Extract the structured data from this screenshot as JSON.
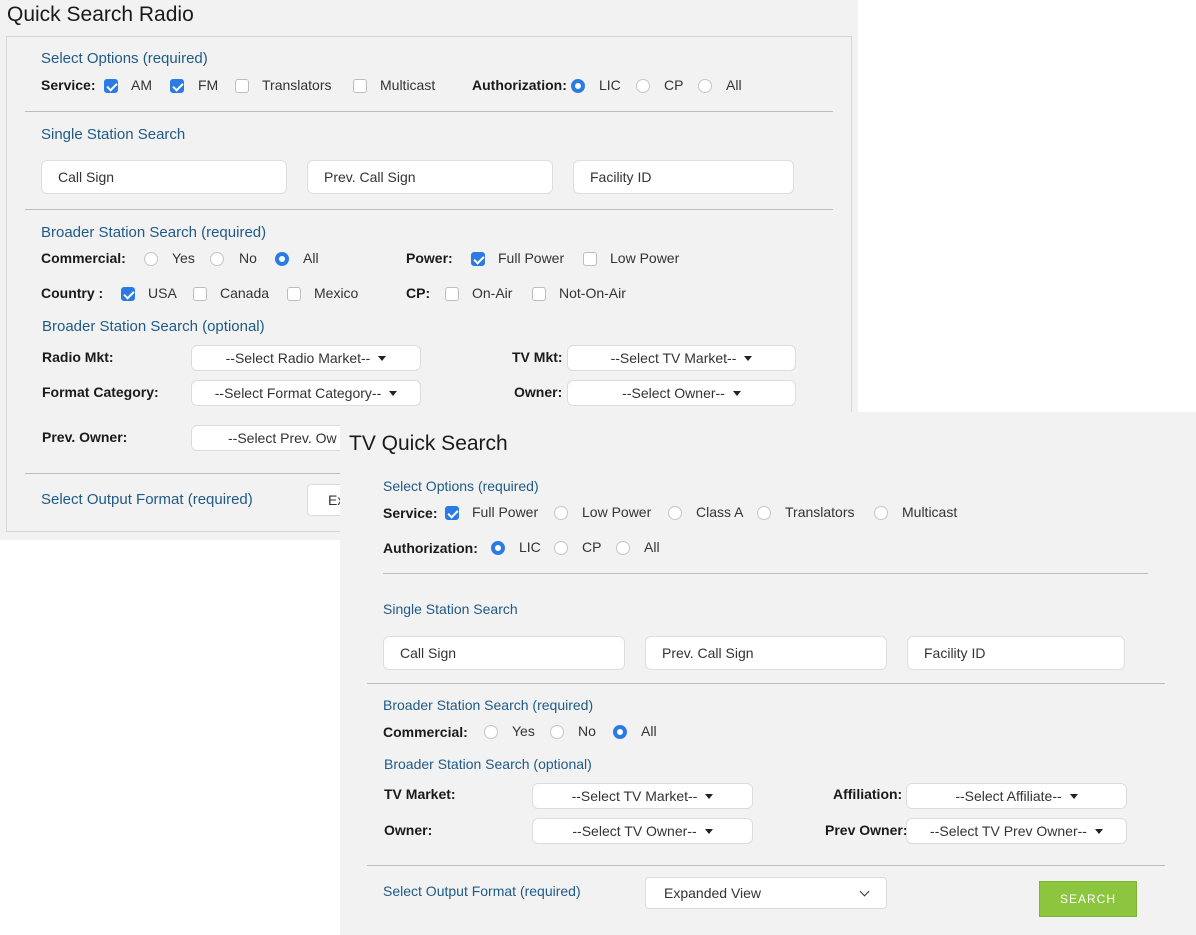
{
  "radio": {
    "title": "Quick Search Radio",
    "select_options": {
      "heading": "Select Options (required)",
      "service_label": "Service:",
      "service": [
        {
          "label": "AM",
          "checked": true
        },
        {
          "label": "FM",
          "checked": true
        },
        {
          "label": "Translators",
          "checked": false
        },
        {
          "label": "Multicast",
          "checked": false
        }
      ],
      "authorization_label": "Authorization:",
      "authorization": [
        {
          "label": "LIC",
          "checked": true
        },
        {
          "label": "CP",
          "checked": false
        },
        {
          "label": "All",
          "checked": false
        }
      ]
    },
    "single": {
      "heading": "Single Station Search",
      "call_sign": "Call Sign",
      "prev_call_sign": "Prev. Call Sign",
      "facility_id": "Facility ID"
    },
    "broader_required": {
      "heading": "Broader Station Search (required)",
      "commercial_label": "Commercial:",
      "commercial": [
        {
          "label": "Yes",
          "checked": false
        },
        {
          "label": "No",
          "checked": false
        },
        {
          "label": "All",
          "checked": true
        }
      ],
      "power_label": "Power:",
      "power": [
        {
          "label": "Full Power",
          "checked": true
        },
        {
          "label": "Low Power",
          "checked": false
        }
      ],
      "country_label": "Country :",
      "country": [
        {
          "label": "USA",
          "checked": true
        },
        {
          "label": "Canada",
          "checked": false
        },
        {
          "label": "Mexico",
          "checked": false
        }
      ],
      "cp_label": "CP:",
      "cp": [
        {
          "label": "On-Air",
          "checked": false
        },
        {
          "label": "Not-On-Air",
          "checked": false
        }
      ]
    },
    "broader_optional": {
      "heading": "Broader Station Search (optional)",
      "radio_mkt_label": "Radio Mkt:",
      "radio_mkt_value": "--Select Radio Market--",
      "tv_mkt_label": "TV Mkt:",
      "tv_mkt_value": "--Select TV Market--",
      "format_label": "Format Category:",
      "format_value": "--Select Format Category--",
      "owner_label": "Owner:",
      "owner_value": "--Select Owner--",
      "prev_owner_label": "Prev. Owner:",
      "prev_owner_value": "--Select Prev. Ow"
    },
    "output": {
      "heading": "Select Output Format (required)",
      "value": "Ex"
    }
  },
  "tv": {
    "title": "TV Quick Search",
    "select_options": {
      "heading": "Select Options (required)",
      "service_label": "Service:",
      "service": [
        {
          "label": "Full Power",
          "checked": true
        },
        {
          "label": "Low Power",
          "checked": false
        },
        {
          "label": "Class A",
          "checked": false
        },
        {
          "label": "Translators",
          "checked": false
        },
        {
          "label": "Multicast",
          "checked": false
        }
      ],
      "authorization_label": "Authorization:",
      "authorization": [
        {
          "label": "LIC",
          "checked": true
        },
        {
          "label": "CP",
          "checked": false
        },
        {
          "label": "All",
          "checked": false
        }
      ]
    },
    "single": {
      "heading": "Single Station Search",
      "call_sign": "Call Sign",
      "prev_call_sign": "Prev. Call Sign",
      "facility_id": "Facility ID"
    },
    "broader_required": {
      "heading": "Broader Station Search (required)",
      "commercial_label": "Commercial:",
      "commercial": [
        {
          "label": "Yes",
          "checked": false
        },
        {
          "label": "No",
          "checked": false
        },
        {
          "label": "All",
          "checked": true
        }
      ]
    },
    "broader_optional": {
      "heading": "Broader Station Search (optional)",
      "tv_market_label": "TV Market:",
      "tv_market_value": "--Select TV Market--",
      "affiliation_label": "Affiliation:",
      "affiliation_value": "--Select Affiliate--",
      "owner_label": "Owner:",
      "owner_value": "--Select TV Owner--",
      "prev_owner_label": "Prev Owner:",
      "prev_owner_value": "--Select TV Prev Owner--"
    },
    "output": {
      "heading": "Select Output Format (required)",
      "value": "Expanded View",
      "search_label": "SEARCH"
    }
  },
  "colors": {
    "accent_blue": "#2c7be5",
    "heading_blue": "#1f5a86",
    "search_green": "#8cc63f",
    "panel_bg": "#f2f2f2"
  }
}
